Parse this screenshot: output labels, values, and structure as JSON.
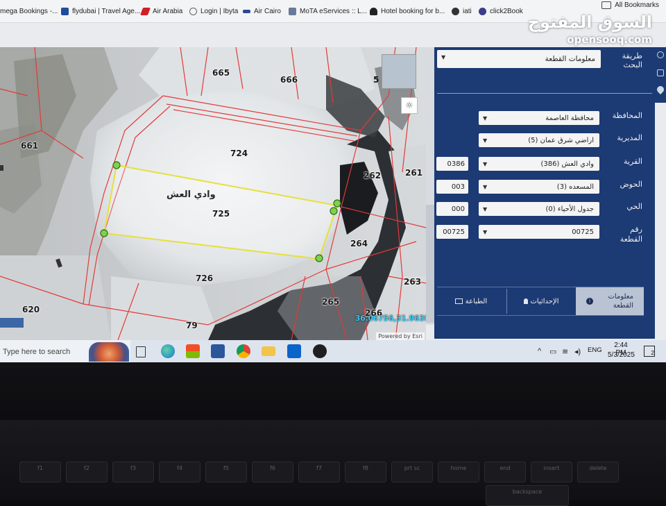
{
  "bookmarks": {
    "items": [
      {
        "label": "mega Bookings -...",
        "icon": "bookmark-icon",
        "color": "#3d6fc4"
      },
      {
        "label": "flydubai | Travel Age...",
        "icon": "flydubai-icon",
        "color": "#1e4d9b"
      },
      {
        "label": "Air Arabia",
        "icon": "air-arabia-icon",
        "color": "#d21f26"
      },
      {
        "label": "Login | Ibyta",
        "icon": "globe-icon",
        "color": "#5f6368"
      },
      {
        "label": "Air Cairo",
        "icon": "air-cairo-icon",
        "color": "#2b4a8f"
      },
      {
        "label": "MoTA eServices :: L...",
        "icon": "mota-icon",
        "color": "#6a7b9a"
      },
      {
        "label": "Hotel booking for b...",
        "icon": "hotel-icon",
        "color": "#222222"
      },
      {
        "label": "iati",
        "icon": "iati-icon",
        "color": "#333333"
      },
      {
        "label": "click2Book",
        "icon": "click2book-icon",
        "color": "#3b3d8c"
      }
    ],
    "all_label": "All Bookmarks"
  },
  "logo": {
    "arabic": "السوق المفتوح",
    "english": "opensooq.com"
  },
  "map": {
    "parcels": [
      {
        "id": "p665",
        "label": "665"
      },
      {
        "id": "p666",
        "label": "666"
      },
      {
        "id": "p661",
        "label": "661"
      },
      {
        "id": "p724",
        "label": "724"
      },
      {
        "id": "p725",
        "label": "725"
      },
      {
        "id": "p262",
        "label": "262"
      },
      {
        "id": "p261",
        "label": "261"
      },
      {
        "id": "p264",
        "label": "264"
      },
      {
        "id": "p726",
        "label": "726"
      },
      {
        "id": "p263",
        "label": "263"
      },
      {
        "id": "p265",
        "label": "265"
      },
      {
        "id": "p266",
        "label": "266"
      },
      {
        "id": "p620",
        "label": "620"
      },
      {
        "id": "p79",
        "label": "79"
      },
      {
        "id": "p5",
        "label": "5"
      }
    ],
    "area_name": "وادي العش",
    "coordinates": "36.06756,31.96384",
    "attribution": "Powered by Esri"
  },
  "panel": {
    "search_method_label": "طريقة البحث",
    "search_method_value": "معلومات القطعة",
    "fields": [
      {
        "label": "المحافظة",
        "value": "محافظة العاصمة",
        "code": ""
      },
      {
        "label": "المديرية",
        "value": "اراضي شرق عمان (5)",
        "code": ""
      },
      {
        "label": "القرية",
        "value": "وادي العش (386)",
        "code": "0386"
      },
      {
        "label": "الحوض",
        "value": "المسعده (3)",
        "code": "003"
      },
      {
        "label": "الحي",
        "value": "جدول الأحياء (0)",
        "code": "000"
      },
      {
        "label": "رقم القطعة",
        "value": "00725",
        "code": "00725"
      }
    ],
    "tabs": [
      {
        "label": "معلومات القطعة",
        "icon": "info-icon",
        "active": true
      },
      {
        "label": "الإحداثيات",
        "icon": "user-pin-icon",
        "active": false
      },
      {
        "label": "الطباعة",
        "icon": "print-icon",
        "active": false
      }
    ],
    "colors": {
      "panel": "#1c3a73",
      "active_tab": "#b9c3d3"
    }
  },
  "taskbar": {
    "search_placeholder": "Type here to search",
    "apps": [
      "task-view-icon",
      "edge-icon",
      "store-icon",
      "word-icon",
      "chrome-icon",
      "file-explorer-icon",
      "outlook-icon",
      "app-icon"
    ],
    "language": "ENG",
    "time": "2:44 PM",
    "date": "5/3/2025",
    "notification_count": "2"
  },
  "keyboard": {
    "keys": [
      "f1",
      "f2",
      "f3",
      "f4",
      "f5",
      "f6",
      "f7",
      "f8",
      "prt sc",
      "home",
      "end",
      "insert",
      "delete",
      "backspace"
    ]
  }
}
